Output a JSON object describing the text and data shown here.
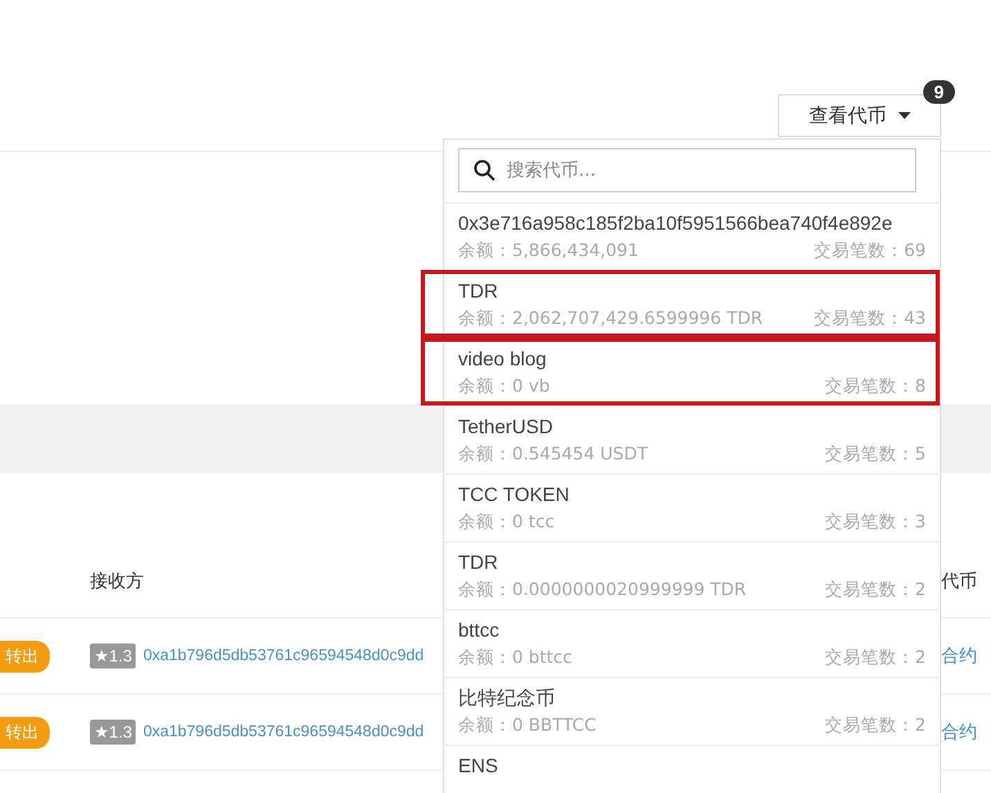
{
  "toolbar": {
    "view_tokens_button": "查看代币",
    "count_badge": "9"
  },
  "table": {
    "columns": [
      "接收方",
      "代币"
    ],
    "rows": [
      {
        "direction": "转出",
        "rank": "★1.3",
        "receiver": "0xa1b796d5db53761c96594548d0c9dd",
        "token_link": "合约"
      },
      {
        "direction": "转出",
        "rank": "★1.3",
        "receiver": "0xa1b796d5db53761c96594548d0c9dd",
        "token_link": "合约"
      }
    ]
  },
  "token_dropdown": {
    "search": {
      "placeholder": "搜索代币..."
    },
    "items": [
      {
        "name": "0x3e716a958c185f2ba10f5951566bea740f4e892e",
        "balance": "余额：5,866,434,091",
        "transactions": "交易笔数：69",
        "highlighted": false
      },
      {
        "name": "TDR",
        "balance": "余额：2,062,707,429.6599996 TDR",
        "transactions": "交易笔数：43",
        "highlighted": true
      },
      {
        "name": "video blog",
        "balance": "余额：0 vb",
        "transactions": "交易笔数：8",
        "highlighted": true
      },
      {
        "name": "TetherUSD",
        "balance": "余额：0.545454 USDT",
        "transactions": "交易笔数：5",
        "highlighted": false
      },
      {
        "name": "TCC TOKEN",
        "balance": "余额：0 tcc",
        "transactions": "交易笔数：3",
        "highlighted": false
      },
      {
        "name": "TDR",
        "balance": "余额：0.0000000020999999 TDR",
        "transactions": "交易笔数：2",
        "highlighted": false
      },
      {
        "name": "bttcc",
        "balance": "余额：0 bttcc",
        "transactions": "交易笔数：2",
        "highlighted": false
      },
      {
        "name": "比特纪念币",
        "balance": "余额：0 BBTTCC",
        "transactions": "交易笔数：2",
        "highlighted": false
      },
      {
        "name": "ENS",
        "highlighted": false
      }
    ]
  }
}
